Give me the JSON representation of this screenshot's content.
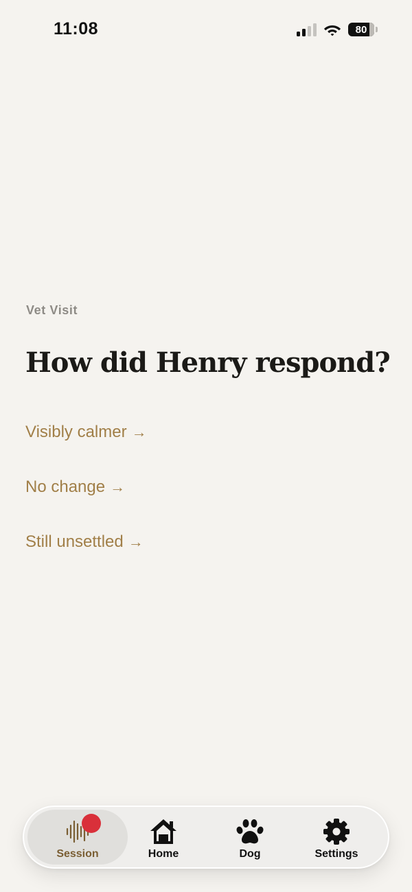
{
  "status_bar": {
    "time": "11:08",
    "battery_level": "80",
    "icons": [
      "signal-icon",
      "wifi-icon",
      "battery-icon"
    ]
  },
  "screen": {
    "eyebrow": "Vet Visit",
    "question": "How did Henry respond?"
  },
  "options": [
    {
      "label": "Visibly calmer",
      "arrow": "→"
    },
    {
      "label": "No change",
      "arrow": "→"
    },
    {
      "label": "Still unsettled",
      "arrow": "→"
    }
  ],
  "tab_bar": {
    "tabs": [
      {
        "label": "Session",
        "icon": "waveform-icon",
        "active": true
      },
      {
        "label": "Home",
        "icon": "home-icon",
        "active": false
      },
      {
        "label": "Dog",
        "icon": "paw-icon",
        "active": false
      },
      {
        "label": "Settings",
        "icon": "gear-icon",
        "active": false
      }
    ]
  },
  "colors": {
    "background": "#f5f3ef",
    "accent": "#a17f48",
    "recording_dot": "#d9303a",
    "heading": "#1b1a17",
    "muted": "#8e8b86"
  }
}
